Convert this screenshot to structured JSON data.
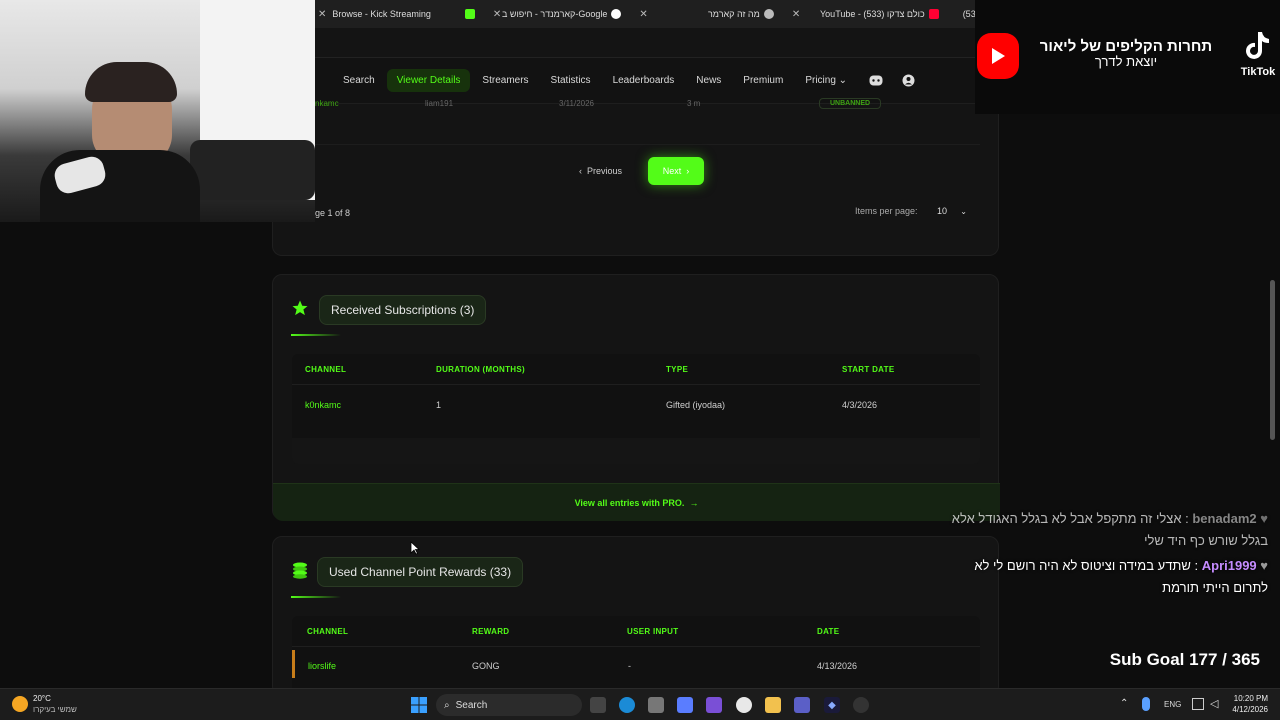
{
  "tabs": [
    {
      "label": "Browse - Kick Streaming",
      "close": "✕"
    },
    {
      "label": "קארמנדר - חיפוש ב-Google",
      "close": "✕"
    },
    {
      "label": "מה זה קארמר",
      "close": "✕"
    },
    {
      "label": "YouTube - (533) כולם צדקו",
      "close": "✕"
    },
    {
      "label": "(53",
      "close": ""
    }
  ],
  "nav": {
    "items": [
      "Search",
      "Viewer Details",
      "Streamers",
      "Statistics",
      "Leaderboards",
      "News",
      "Premium",
      "Pricing"
    ],
    "active_index": 1,
    "pricing_chevron": "⌄"
  },
  "prev_table": {
    "row": [
      "nkamc",
      "liam191",
      "3/11/2026",
      "3 m",
      "UNBANNED"
    ]
  },
  "pagination": {
    "previous_label": "Previous",
    "next_label": "Next",
    "page_info": "ge 1 of 8",
    "items_per_page_label": "Items per page:",
    "items_per_page_value": "10"
  },
  "subscriptions": {
    "title": "Received Subscriptions (3)",
    "headers": [
      "CHANNEL",
      "DURATION (MONTHS)",
      "TYPE",
      "START DATE"
    ],
    "rows": [
      [
        "k0nkamc",
        "1",
        "Gifted (iyodaa)",
        "4/3/2026"
      ]
    ],
    "pro_link": "View all entries with PRO."
  },
  "rewards": {
    "title": "Used Channel Point Rewards (33)",
    "headers": [
      "CHANNEL",
      "REWARD",
      "USER INPUT",
      "DATE"
    ],
    "rows": [
      [
        "liorslife",
        "GONG",
        "-",
        "4/13/2026"
      ]
    ]
  },
  "tiktok": {
    "headline": "תחרות הקליפים של ליאור",
    "subline": "יוצאת לדרך",
    "brand": "TikTok"
  },
  "chat": [
    {
      "user": "benadam2",
      "text": ": אצלי זה מתקפל אבל לא בגלל האגודל אלא בגלל שורש כף היד שלי"
    },
    {
      "user": "Apri1999",
      "text": ": שתדע במידה וציטוס לא היה רושם לי לא לתרום הייתי תורמת"
    }
  ],
  "sub_goal": "Sub Goal 177 / 365",
  "taskbar": {
    "weather_temp": "20°C",
    "weather_desc": "שמשי בעיקרו",
    "search_label": "Search",
    "lang": "ENG",
    "time": "10:20 PM",
    "date": "4/12/2026"
  },
  "colors": {
    "accent": "#53fc18"
  }
}
